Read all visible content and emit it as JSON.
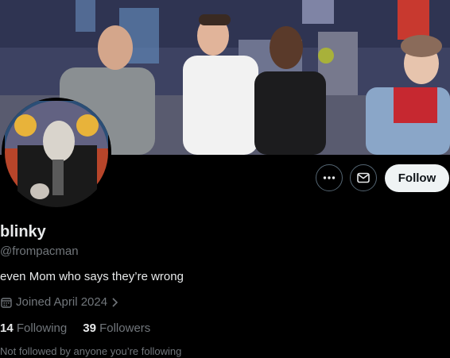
{
  "profile": {
    "display_name": "blinky",
    "handle": "@frompacman",
    "bio": "even Mom who says they’re wrong",
    "joined": "Joined April 2024",
    "following_count": "14",
    "following_label": "Following",
    "followers_count": "39",
    "followers_label": "Followers",
    "followed_by_note": "Not followed by anyone you’re following"
  },
  "actions": {
    "follow_label": "Follow",
    "more_icon": "more-horizontal-icon",
    "message_icon": "envelope-icon"
  },
  "colors": {
    "background": "#000000",
    "primary_text": "#e7e9ea",
    "secondary_text": "#71767b",
    "follow_bg": "#eff3f4"
  }
}
